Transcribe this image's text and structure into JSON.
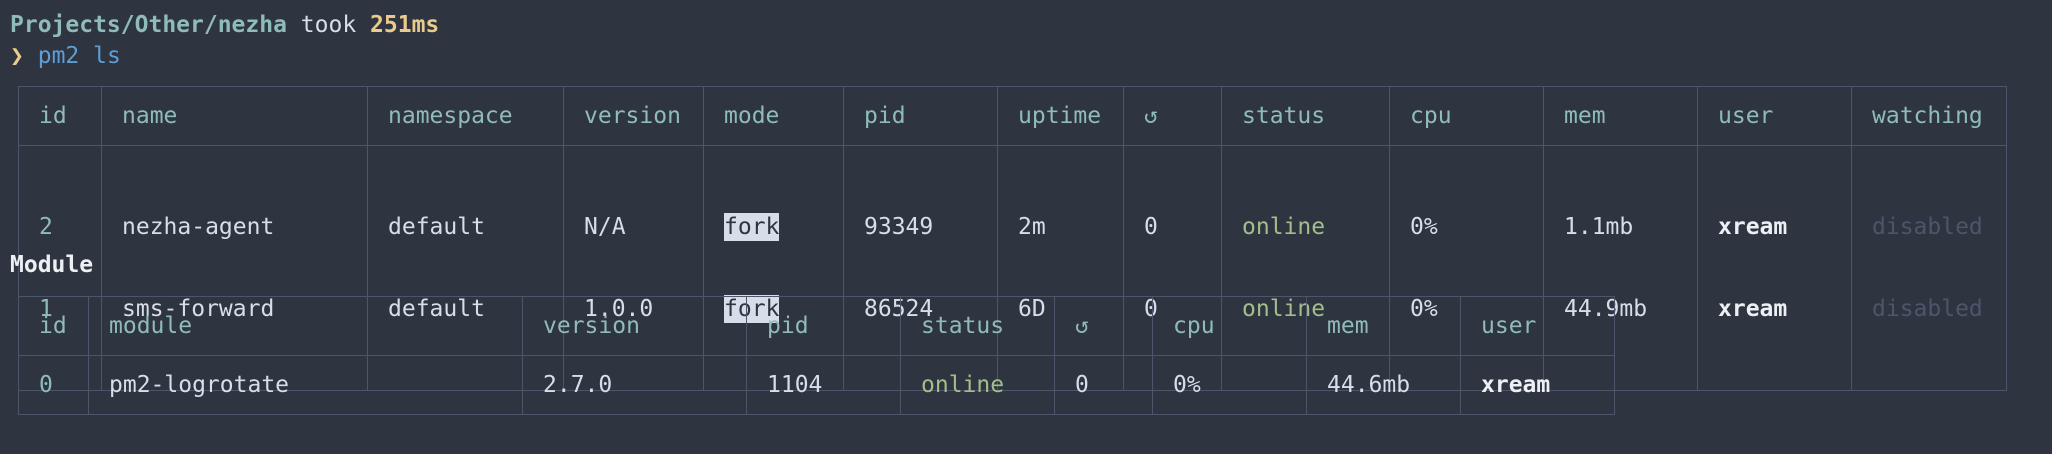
{
  "terminal": {
    "path": "Projects/Other/nezha",
    "took_word": " took ",
    "took_value": "251ms",
    "prompt_symbol": "❯",
    "command_name": "pm2",
    "command_args": " ls"
  },
  "process_table": {
    "headers": [
      "id",
      "name",
      "namespace",
      "version",
      "mode",
      "pid",
      "uptime",
      "↺",
      "status",
      "cpu",
      "mem",
      "user",
      "watching"
    ],
    "rows": [
      {
        "id": "2",
        "name": "nezha-agent",
        "namespace": "default",
        "version": "N/A",
        "mode": "fork",
        "pid": "93349",
        "uptime": "2m",
        "restarts": "0",
        "status": "online",
        "cpu": "0%",
        "mem": "1.1mb",
        "user": "xream",
        "watching": "disabled"
      },
      {
        "id": "1",
        "name": "sms-forward",
        "namespace": "default",
        "version": "1.0.0",
        "mode": "fork",
        "pid": "86524",
        "uptime": "6D",
        "restarts": "0",
        "status": "online",
        "cpu": "0%",
        "mem": "44.9mb",
        "user": "xream",
        "watching": "disabled"
      }
    ]
  },
  "module_section": {
    "title": "Module",
    "headers": [
      "id",
      "module",
      "version",
      "pid",
      "status",
      "↺",
      "cpu",
      "mem",
      "user"
    ],
    "rows": [
      {
        "id": "0",
        "module": "pm2-logrotate",
        "version": "2.7.0",
        "pid": "1104",
        "status": "online",
        "restarts": "0",
        "cpu": "0%",
        "mem": "44.6mb",
        "user": "xream"
      }
    ]
  },
  "colors": {
    "background": "#2e3440",
    "path": "#8fbcbb",
    "took_value": "#ebcb8b",
    "online": "#a3be8c",
    "border": "#4c566a"
  }
}
